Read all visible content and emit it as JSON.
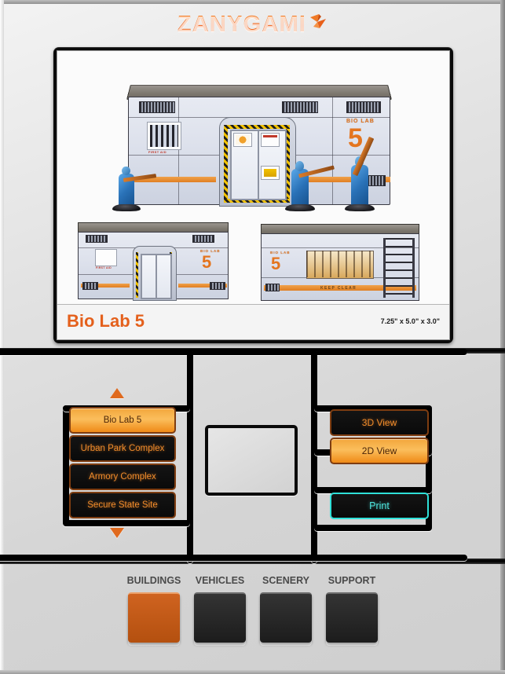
{
  "brand": {
    "name": "ZANYGAMI",
    "accent_color": "#ef6a1b",
    "crane_icon": "origami-crane-icon"
  },
  "viewer": {
    "caption_title": "Bio Lab 5",
    "dimensions": "7.25\" x 5.0\" x 3.0\"",
    "model_signage": {
      "label": "BIO LAB",
      "number": "5",
      "first_aid": "FIRST AID",
      "keep_clear": "KEEP CLEAR",
      "biohazard": "biohazard-icon",
      "radiation": "radiation-icon",
      "danger": "danger-placard"
    }
  },
  "model_list": {
    "scroll_up": "scroll-up-arrow",
    "scroll_down": "scroll-down-arrow",
    "selected_index": 0,
    "items": [
      {
        "label": "Bio Lab 5",
        "selected": true
      },
      {
        "label": "Urban Park Complex",
        "selected": false
      },
      {
        "label": "Armory Complex",
        "selected": false
      },
      {
        "label": "Secure State Site",
        "selected": false
      }
    ]
  },
  "preview": {
    "empty": ""
  },
  "view_controls": {
    "buttons": [
      {
        "label": "3D View",
        "selected": false
      },
      {
        "label": "2D View",
        "selected": true
      }
    ],
    "print_label": "Print",
    "print_color": "#2fe0d8"
  },
  "tabs": {
    "selected_index": 0,
    "items": [
      {
        "label": "BUILDINGS",
        "selected": true
      },
      {
        "label": "VEHICLES",
        "selected": false
      },
      {
        "label": "SCENERY",
        "selected": false
      },
      {
        "label": "SUPPORT",
        "selected": false
      }
    ]
  }
}
